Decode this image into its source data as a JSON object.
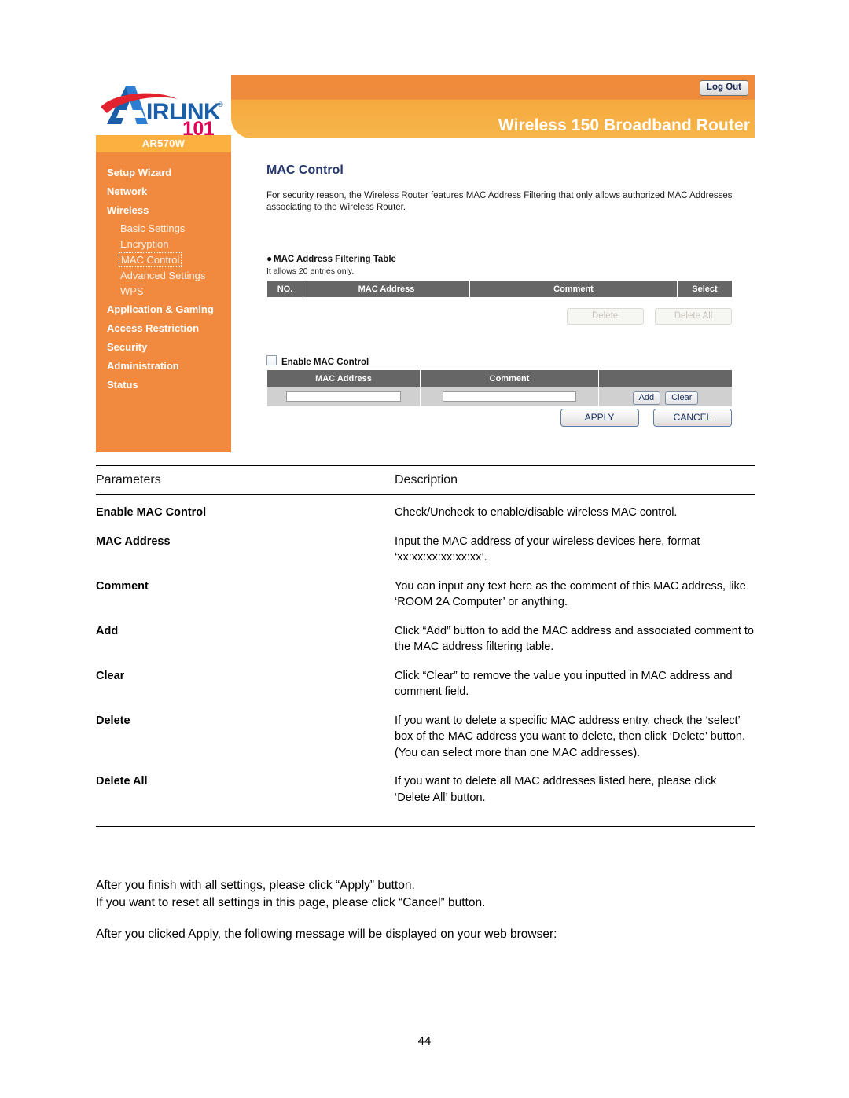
{
  "router_ui": {
    "brand": {
      "logo_text_main": "IRLINK",
      "logo_text_a": "A",
      "logo_text_101": "101",
      "logo_registered": "®",
      "model": "AR570W"
    },
    "header": {
      "title": "Wireless 150 Broadband Router",
      "logout_label": "Log Out",
      "band_color": "#f08b3c",
      "model_tab_color": "#fbb040"
    },
    "sidebar": {
      "bg_color": "#f18a3f",
      "items": [
        {
          "label": "Setup Wizard",
          "level": "top",
          "active": false
        },
        {
          "label": "Network",
          "level": "top",
          "active": false
        },
        {
          "label": "Wireless",
          "level": "top",
          "active": false
        },
        {
          "label": "Basic Settings",
          "level": "sub",
          "active": false
        },
        {
          "label": "Encryption",
          "level": "sub",
          "active": false
        },
        {
          "label": "MAC Control",
          "level": "sub",
          "active": true
        },
        {
          "label": "Advanced Settings",
          "level": "sub",
          "active": false
        },
        {
          "label": "WPS",
          "level": "sub",
          "active": false
        },
        {
          "label": "Application & Gaming",
          "level": "top",
          "active": false
        },
        {
          "label": "Access Restriction",
          "level": "top",
          "active": false
        },
        {
          "label": "Security",
          "level": "top",
          "active": false
        },
        {
          "label": "Administration",
          "level": "top",
          "active": false
        },
        {
          "label": "Status",
          "level": "top",
          "active": false
        }
      ]
    },
    "content": {
      "title": "MAC Control",
      "title_color": "#23366d",
      "description": "For security reason, the Wireless Router features MAC Address Filtering that only allows authorized MAC Addresses associating to the Wireless Router.",
      "section_heading": "MAC Address Filtering Table",
      "entries_note": "It allows 20 entries only.",
      "filter_table_headers": [
        "NO.",
        "MAC Address",
        "Comment",
        "Select"
      ],
      "delete_button": "Delete",
      "delete_all_button": "Delete All",
      "enable_checkbox_label": "Enable MAC Control",
      "enable_checkbox_checked": false,
      "input_table_headers": [
        "MAC Address",
        "Comment",
        ""
      ],
      "mac_input_value": "",
      "comment_input_value": "",
      "add_button": "Add",
      "clear_button": "Clear",
      "apply_button": "APPLY",
      "cancel_button": "CANCEL"
    }
  },
  "doc": {
    "col_headers": {
      "parameters": "Parameters",
      "description": "Description"
    },
    "rows": [
      {
        "parameter": "Enable MAC Control",
        "description": "Check/Uncheck to enable/disable wireless MAC control."
      },
      {
        "parameter": "MAC Address",
        "description": "Input the MAC address of your wireless devices here, format ‘xx:xx:xx:xx:xx:xx’."
      },
      {
        "parameter": "Comment",
        "description": "You can input any text here as the comment of this MAC address, like ‘ROOM 2A Computer’ or anything."
      },
      {
        "parameter": "Add",
        "description": "Click “Add” button to add the MAC address and associated comment to the MAC address filtering table."
      },
      {
        "parameter": "Clear",
        "description": "Click “Clear” to remove the value you inputted in MAC address and comment field."
      },
      {
        "parameter": "Delete",
        "description": "If you want to delete a specific MAC address entry, check the ‘select’ box of the MAC address you want to delete, then click ‘Delete’ button. (You can select more than one MAC addresses)."
      },
      {
        "parameter": "Delete All",
        "description": "If you want to delete all MAC addresses listed here, please click ‘Delete All’ button."
      }
    ]
  },
  "notes": {
    "line1": "After you finish with all settings, please click “Apply” button.",
    "line2": "If you want to reset all settings in this page, please click “Cancel” button.",
    "line3": "After you clicked Apply, the following message will be displayed on your web browser:"
  },
  "page_number": "44"
}
